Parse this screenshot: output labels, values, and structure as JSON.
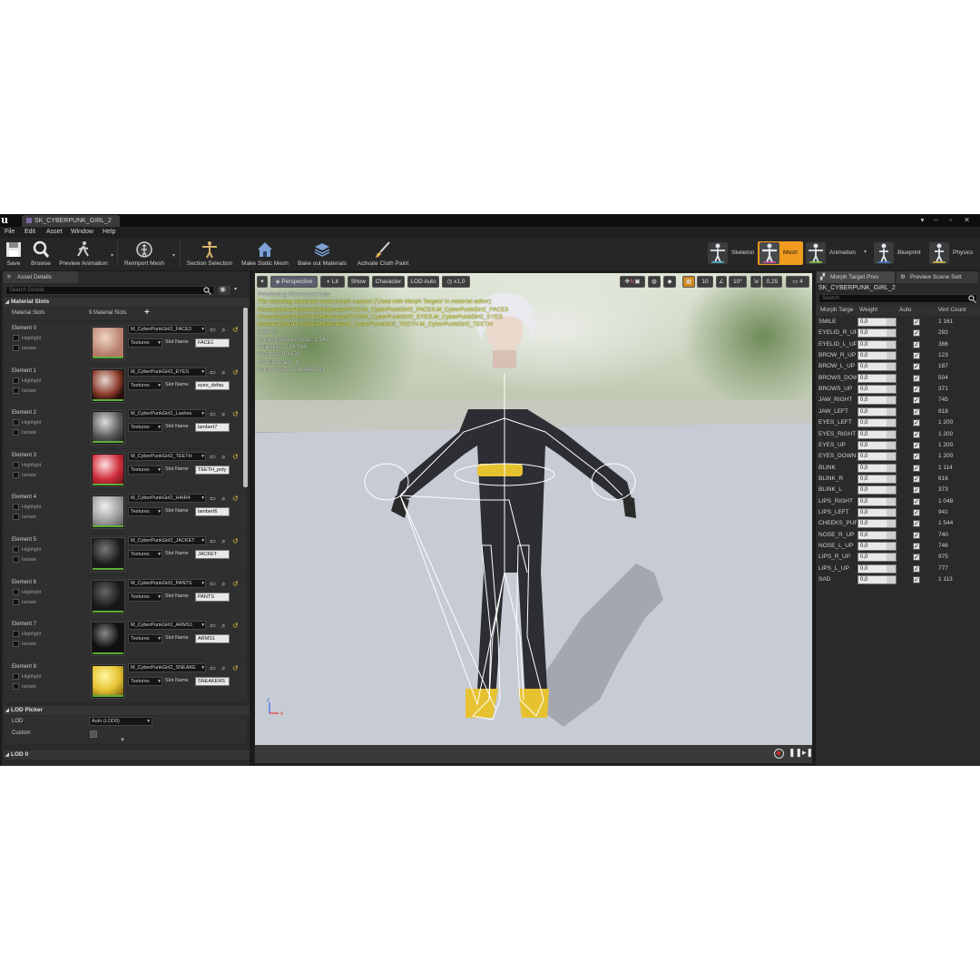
{
  "window": {
    "tab_title": "SK_CYBERPUNK_GIRL_2",
    "controls": [
      "▾",
      "–",
      "▫",
      "✕"
    ]
  },
  "menu": [
    "File",
    "Edit",
    "Asset",
    "Window",
    "Help"
  ],
  "toolbar": {
    "save": "Save",
    "browse": "Browse",
    "preview_animation": "Preview Animation",
    "reimport_mesh": "Reimport Mesh",
    "section_selection": "Section Selection",
    "make_static_mesh": "Make Static Mesh",
    "bake_out_materials": "Bake out Materials",
    "activate_cloth_paint": "Activate Cloth Paint",
    "modes": {
      "skeleton": "Skeleton",
      "mesh": "Mesh",
      "animation": "Animation",
      "blueprint": "Blueprint",
      "physics": "Physics"
    },
    "active_mode_color": "#f09a1e"
  },
  "asset_details": {
    "tab": "Asset Details",
    "search_placeholder": "Search Details",
    "material_slots_header": "Material Slots",
    "material_slots_label": "Material Slots",
    "material_slots_count": "9 Material Slots",
    "textures_label": "Textures",
    "slot_name_label": "Slot Name",
    "highlight_label": "Highlight",
    "isolate_label": "Isolate",
    "elements": [
      {
        "label": "Element 0",
        "material": "M_CyberPunkGirl2_FACE3",
        "slot": "FACE1"
      },
      {
        "label": "Element 1",
        "material": "M_CyberPunkGirl2_EYES",
        "slot": "eyes_defau"
      },
      {
        "label": "Element 2",
        "material": "M_CyberPunkGirl2_Lashes",
        "slot": "lambert7"
      },
      {
        "label": "Element 3",
        "material": "M_CyberPunkGirl2_TEETH",
        "slot": "TEETH_poly"
      },
      {
        "label": "Element 4",
        "material": "M_CyberPunkGirl2_HAIR4",
        "slot": "lambert6"
      },
      {
        "label": "Element 5",
        "material": "M_CyberPunkGirl2_JACKET",
        "slot": "JACKET"
      },
      {
        "label": "Element 6",
        "material": "M_CyberPunkGirl2_PANTS",
        "slot": "PANTS"
      },
      {
        "label": "Element 7",
        "material": "M_CyberPunkGirl2_ARMS1",
        "slot": "ARMS1"
      },
      {
        "label": "Element 8",
        "material": "M_CyberPunkGirl2_SNEAKE",
        "slot": "SNEAKERS"
      }
    ],
    "lod_picker_header": "LOD Picker",
    "lod_label": "LOD",
    "lod_value": "Auto (LOD0)",
    "custom_label": "Custom",
    "lod0_header": "LOD 0"
  },
  "viewport": {
    "perspective": "Perspective",
    "lit": "Lit",
    "show": "Show",
    "character": "Character",
    "lod_auto": "LOD Auto",
    "speed": "x1,0",
    "snap_translate": "10",
    "snap_rotate": "10°",
    "snap_scale": "0,25",
    "camera_speed": "4",
    "overlay_lines": [
      "Previewing Reference Pose",
      "The following materials need morph support ('Used with Morph Targets' in material editor):",
      "/Game/CyberPunkGirl2/Materials/FACE/M_CyberPunkGirl2_FACE3.M_CyberPunkGirl2_FACE3",
      "/Game/CyberPunkGirl2/Materials/EYES/M_CyberPunkGirl2_EYES.M_CyberPunkGirl2_EYES",
      "/Game/CyberPunkGirl2/Materials/M_CyberPunkGirl2_TEETH.M_CyberPunkGirl2_TEETH",
      "LOD: 0",
      "Current Screen Size: 1,543",
      "Triangles: 134,384",
      "Vertices: 80,679",
      "UV Channels: 1",
      "Approx Size: 218x84x281"
    ],
    "overlay_colors": [
      "#d9d9d9",
      "#e8e84a",
      "#e8e84a",
      "#e8e84a",
      "#e8e84a",
      "#d9d9d9",
      "#d9d9d9",
      "#d9d9d9",
      "#d9d9d9",
      "#d9d9d9",
      "#d9d9d9"
    ]
  },
  "morph_panel": {
    "tab": "Morph Target Prev",
    "tab2": "Preview Scene Sett",
    "mesh_name": "SK_CYBERPUNK_GIRL_2",
    "search_placeholder": "Search",
    "columns": [
      "Morph Targe",
      "Weight",
      "Auto",
      "Vert Count"
    ],
    "rows": [
      {
        "name": "SMILE",
        "weight": "0,0",
        "verts": "1 161"
      },
      {
        "name": "EYELID_R_UP",
        "weight": "0,0",
        "verts": "292"
      },
      {
        "name": "EYELID_L_UP",
        "weight": "0,0",
        "verts": "366"
      },
      {
        "name": "BROW_R_UP",
        "weight": "0,0",
        "verts": "123"
      },
      {
        "name": "BROW_L_UP",
        "weight": "0,0",
        "verts": "187"
      },
      {
        "name": "BROWS_DOWN",
        "weight": "0,0",
        "verts": "504"
      },
      {
        "name": "BROWS_UP",
        "weight": "0,0",
        "verts": "371"
      },
      {
        "name": "JAW_RIGHT",
        "weight": "0,0",
        "verts": "745"
      },
      {
        "name": "JAW_LEFT",
        "weight": "0,0",
        "verts": "818"
      },
      {
        "name": "EYES_LEFT",
        "weight": "0,0",
        "verts": "1 200"
      },
      {
        "name": "EYES_RIGHT",
        "weight": "0,0",
        "verts": "1 200"
      },
      {
        "name": "EYES_UP",
        "weight": "0,0",
        "verts": "1 200"
      },
      {
        "name": "EYES_DOWN",
        "weight": "0,0",
        "verts": "1 200"
      },
      {
        "name": "BLINK",
        "weight": "0,0",
        "verts": "1 114"
      },
      {
        "name": "BLINK_R",
        "weight": "0,0",
        "verts": "616"
      },
      {
        "name": "BLINK_L",
        "weight": "0,0",
        "verts": "373"
      },
      {
        "name": "LIPS_RIGHT",
        "weight": "0,0",
        "verts": "1 048"
      },
      {
        "name": "LIPS_LEFT",
        "weight": "0,0",
        "verts": "941"
      },
      {
        "name": "CHEEKS_PUFF",
        "weight": "0,0",
        "verts": "1 544"
      },
      {
        "name": "NOSE_R_UP",
        "weight": "0,0",
        "verts": "740"
      },
      {
        "name": "NOSE_L_UP",
        "weight": "0,0",
        "verts": "746"
      },
      {
        "name": "LIPS_R_UP",
        "weight": "0,0",
        "verts": "975"
      },
      {
        "name": "LIPS_L_UP",
        "weight": "0,0",
        "verts": "777"
      },
      {
        "name": "SAD",
        "weight": "0,0",
        "verts": "1 113"
      }
    ]
  }
}
